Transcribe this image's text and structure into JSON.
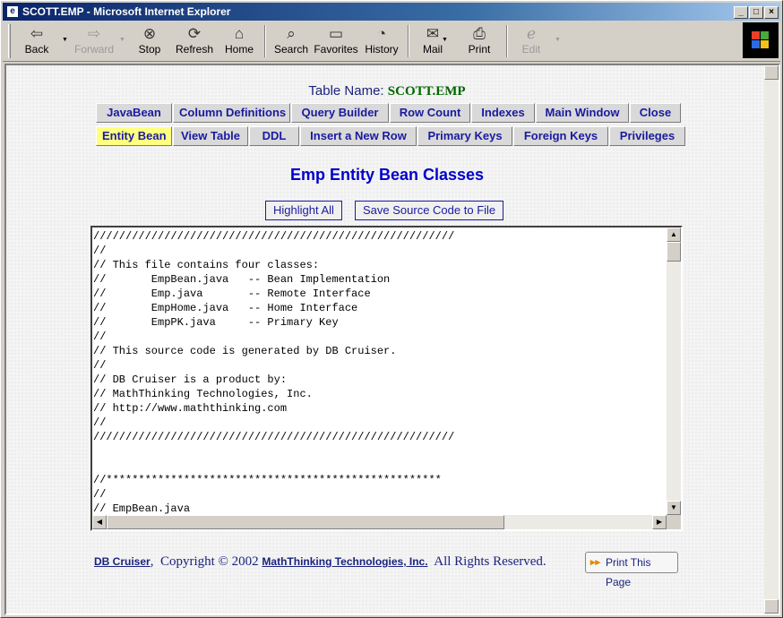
{
  "window": {
    "title": "SCOTT.EMP - Microsoft Internet Explorer",
    "icon": "ie-page-icon",
    "controls": [
      "_",
      "□",
      "×"
    ]
  },
  "toolbar": {
    "back": "Back",
    "forward": "Forward",
    "stop": "Stop",
    "refresh": "Refresh",
    "home": "Home",
    "search": "Search",
    "favorites": "Favorites",
    "history": "History",
    "mail": "Mail",
    "print": "Print",
    "edit": "Edit"
  },
  "page": {
    "table_name_label": "Table Name:",
    "table_name_value": "SCOTT.EMP",
    "nav_row1": [
      "JavaBean",
      "Column Definitions",
      "Query Builder",
      "Row Count",
      "Indexes",
      "Main Window",
      "Close"
    ],
    "nav_row2": [
      "Entity Bean",
      "View Table",
      "DDL",
      "Insert a New Row",
      "Primary Keys",
      "Foreign Keys",
      "Privileges"
    ],
    "active_tab": "Entity Bean",
    "heading": "Emp Entity Bean Classes",
    "highlight_all": "Highlight All",
    "save_source": "Save Source Code to File",
    "code_lines": [
      "////////////////////////////////////////////////////////",
      "//",
      "// This file contains four classes:",
      "//       EmpBean.java   -- Bean Implementation",
      "//       Emp.java       -- Remote Interface",
      "//       EmpHome.java   -- Home Interface",
      "//       EmpPK.java     -- Primary Key",
      "//",
      "// This source code is generated by DB Cruiser.",
      "//",
      "// DB Cruiser is a product by:",
      "// MathThinking Technologies, Inc.",
      "// http://www.maththinking.com",
      "//",
      "////////////////////////////////////////////////////////",
      "",
      "",
      "//****************************************************",
      "//",
      "// EmpBean.java"
    ],
    "footer": {
      "link1": "DB Cruiser",
      "sep": ",",
      "copyright": "Copyright © 2002",
      "link2": "MathThinking Technologies, Inc.",
      "rights": "All Rights Reserved.",
      "print_button": "Print This Page"
    }
  }
}
